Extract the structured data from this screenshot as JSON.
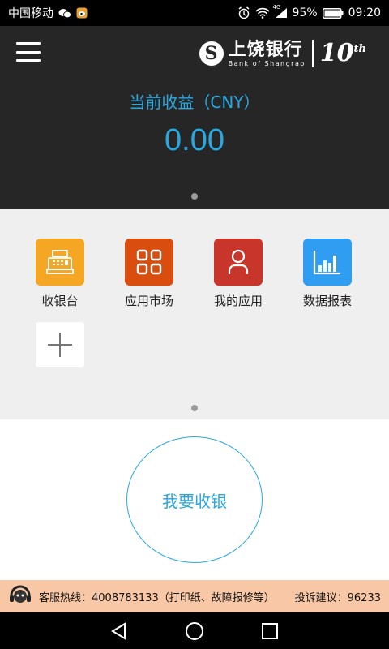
{
  "status_bar": {
    "carrier": "中国移动",
    "network": "4G",
    "battery": "95%",
    "time": "09:20"
  },
  "header": {
    "bank_name_cn": "上饶银行",
    "bank_name_en": "Bank of Shangrao",
    "anniversary": "10",
    "anniversary_suffix": "th",
    "earnings_label": "当前收益（CNY）",
    "earnings_value": "0.00"
  },
  "apps": [
    {
      "label": "收银台",
      "color": "#f5a623",
      "icon": "cash-register-icon"
    },
    {
      "label": "应用市场",
      "color": "#d94e0f",
      "icon": "app-grid-icon"
    },
    {
      "label": "我的应用",
      "color": "#c8352b",
      "icon": "user-icon"
    },
    {
      "label": "数据报表",
      "color": "#2f9ef2",
      "icon": "bar-chart-icon"
    }
  ],
  "main": {
    "cashier_button": "我要收银"
  },
  "hotline": {
    "text": "客服热线：4008783133（打印纸、故障报修等）",
    "complaint": "投诉建议：96233"
  },
  "colors": {
    "accent": "#29a8e0",
    "header_bg": "#262626",
    "hotline_bg": "#f8c7a5"
  }
}
